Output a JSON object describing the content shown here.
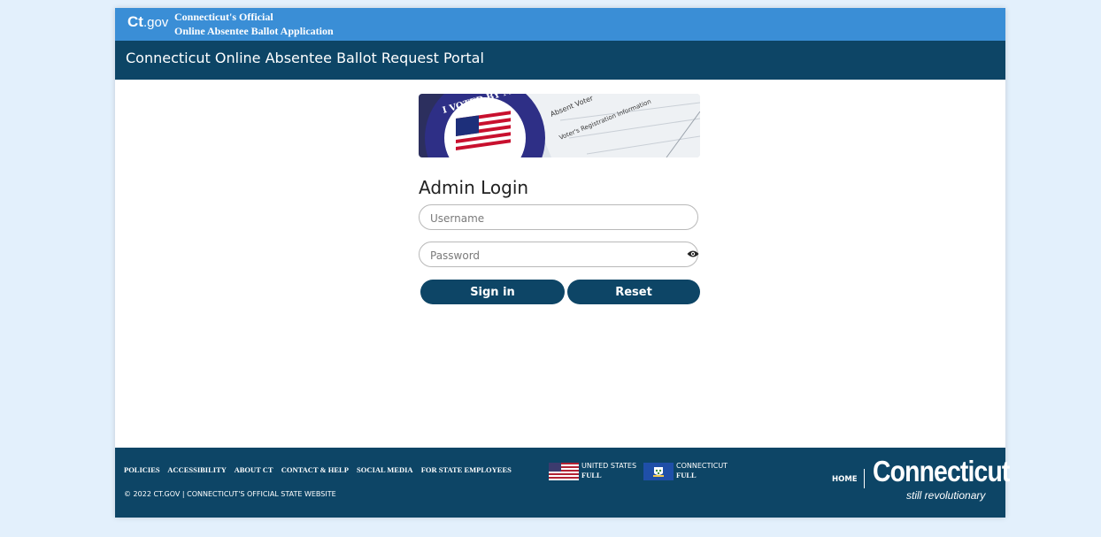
{
  "header": {
    "logo_ct": "Ct",
    "logo_gov": ".gov",
    "official_line1": "Connecticut's Official",
    "official_line2": "Online Absentee Ballot Application"
  },
  "portal_title": "Connecticut Online Absentee Ballot Request Portal",
  "banner": {
    "seal_text": "I VOTED BY MAIL",
    "form_line1": "Absent Voter",
    "form_line2": "Voter's Registration Information"
  },
  "login": {
    "title": "Admin Login",
    "username_placeholder": "Username",
    "password_placeholder": "Password",
    "signin_label": "Sign in",
    "reset_label": "Reset"
  },
  "footer": {
    "links": [
      "POLICIES",
      "ACCESSIBILITY",
      "ABOUT CT",
      "CONTACT & HELP",
      "SOCIAL MEDIA",
      "FOR STATE EMPLOYEES"
    ],
    "us_flag_label": "UNITED STATES",
    "us_flag_status": "FULL",
    "ct_flag_label": "CONNECTICUT",
    "ct_flag_status": "FULL",
    "copyright": "© 2022 CT.GOV | CONNECTICUT'S OFFICIAL STATE WEBSITE",
    "home_label": "HOME",
    "brand": "Connecticut",
    "tagline": "still revolutionary"
  },
  "colors": {
    "page_bg": "#e3f0fc",
    "top_bar": "#3a8ed6",
    "navy": "#0d4566"
  }
}
